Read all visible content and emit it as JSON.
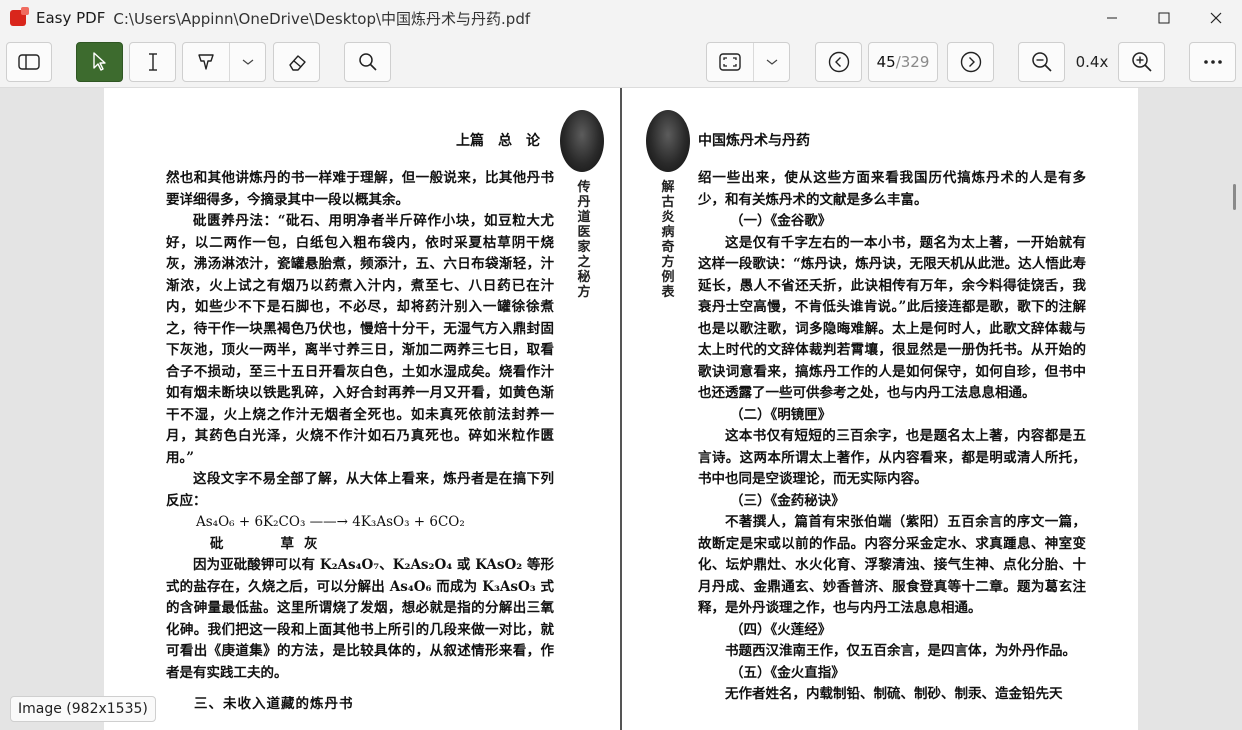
{
  "window": {
    "app_name": "Easy PDF",
    "file_path": "C:\\Users\\Appinn\\OneDrive\\Desktop\\中国炼丹术与丹药.pdf",
    "minimize": "—",
    "maximize": "☐",
    "close": "✕"
  },
  "toolbar": {
    "current_page": "45",
    "total_pages": "/329",
    "zoom": "0.4x"
  },
  "status": {
    "image_info": "Image (982x1535)"
  },
  "left_page": {
    "header": "上篇　总　论",
    "vertical_caption": "传丹道医家之秘方",
    "paragraphs": [
      "然也和其他讲炼丹的书一样难于理解，但一般说来，比其他丹书要详细得多，今摘录其中一段以概其余。",
      "砒匮养丹法：“砒石、用明净者半斤碎作小块，如豆粒大尤好，以二两作一包，白纸包入粗布袋内，依时采夏枯草阴干烧灰，沸汤淋浓汁，瓷罐悬胎煮，频添汁，五、六日布袋渐轻，汁渐浓，火上试之有烟乃以药煮入汁内，煮至七、八日药已在汁内，如些少不下是石脚也，不必尽，却将药汁别入一罐徐徐煮之，待干作一块黑褐色乃伏也，慢焙十分干，无湿气方入鼎封固下灰池，顶火一两半，离半寸养三日，渐加二两养三七日，取看合子不损动，至三十五日开看灰白色，土如水湿成矣。烧看作汁如有烟未断块以铁匙乳碎，入好合封再养一月又开看，如黄色渐干不湿，火上烧之作汁无烟者全死也。如未真死依前法封养一月，其药色白光泽，火烧不作汁如石乃真死也。碎如米粒作匮用。”",
      "这段文字不易全部了解，从大体上看来，炼丹者是在搞下列反应：",
      "As₄O₆ + 6K₂CO₃ ——→ 4K₃AsO₃ + 6CO₂",
      "砒　　草灰",
      "因为亚砒酸钾可以有 K₂As₄O₇、K₂As₂O₄ 或 KAsO₂ 等形式的盐存在，久烧之后，可以分解出 As₄O₆ 而成为 K₃AsO₃ 式的含砷量最低盐。这里所谓烧了发烟，想必就是指的分解出三氧化砷。我们把这一段和上面其他书上所引的几段来做一对比，就可看出《庚道集》的方法，是比较具体的，从叙述情形来看，作者是有实践工夫的。",
      "三、未收入道藏的炼丹书"
    ]
  },
  "right_page": {
    "header": "中国炼丹术与丹药",
    "vertical_caption": "解古炎病奇方例表",
    "paragraphs": [
      "绍一些出来，使从这些方面来看我国历代搞炼丹术的人是有多少，和有关炼丹术的文献是多么丰富。",
      "（一）《金谷歌》",
      "这是仅有千字左右的一本小书，题名为太上著，一开始就有这样一段歌诀：“炼丹诀，炼丹诀，无限天机从此泄。达人悟此寿延长，愚人不省还夭折，此诀相传有万年，余今料得徒饶舌，我衰丹士空高慢，不肯低头谁肯说。”此后接连都是歌，歌下的注解也是以歌注歌，词多隐晦难解。太上是何时人，此歌文辞体裁与太上时代的文辞体裁判若霄壤，很显然是一册伪托书。从开始的歌诀词意看来，搞炼丹工作的人是如何保守，如何自珍，但书中也还透露了一些可供参考之处，也与内丹工法息息相通。",
      "（二）《明镜匣》",
      "这本书仅有短短的三百余字，也是题名太上著，内容都是五言诗。这两本所谓太上著作，从内容看来，都是明或清人所托，书中也同是空谈理论，而无实际内容。",
      "（三）《金药秘诀》",
      "不著撰人，篇首有宋张伯端（紫阳）五百余言的序文一篇，故断定是宋或以前的作品。内容分采金定水、求真踵息、神室变化、坛炉鼎灶、水火化育、浮黎清浊、接气生神、点化分胎、十月丹成、金鼎通玄、妙香普济、服食登真等十二章。题为葛玄注释，是外丹谈理之作，也与内丹工法息息相通。",
      "（四）《火莲经》",
      "书题西汉淮南王作，仅五百余言，是四言体，为外丹作品。",
      "（五）《金火直指》",
      "无作者姓名，内载制铅、制硫、制砂、制汞、造金铅先天"
    ]
  }
}
